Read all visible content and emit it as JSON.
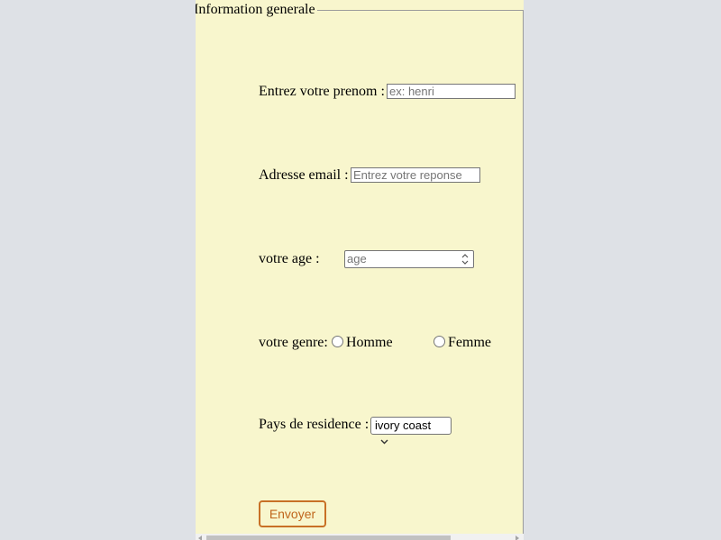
{
  "form": {
    "legend": "Information generale",
    "prenom": {
      "label": "Entrez votre prenom :",
      "placeholder": "ex: henri"
    },
    "email": {
      "label": "Adresse email :",
      "placeholder": "Entrez votre reponse"
    },
    "age": {
      "label": "votre age :",
      "placeholder": "age"
    },
    "genre": {
      "label": "votre genre:",
      "options": [
        "Homme",
        "Femme"
      ]
    },
    "pays": {
      "label": "Pays de residence :",
      "selected": "ivory coast"
    },
    "submit_label": "Envoyer"
  },
  "colors": {
    "page_background": "#dee1e6",
    "form_background": "#f8f6cd",
    "button_border": "#c87026",
    "button_text": "#c0661c"
  }
}
